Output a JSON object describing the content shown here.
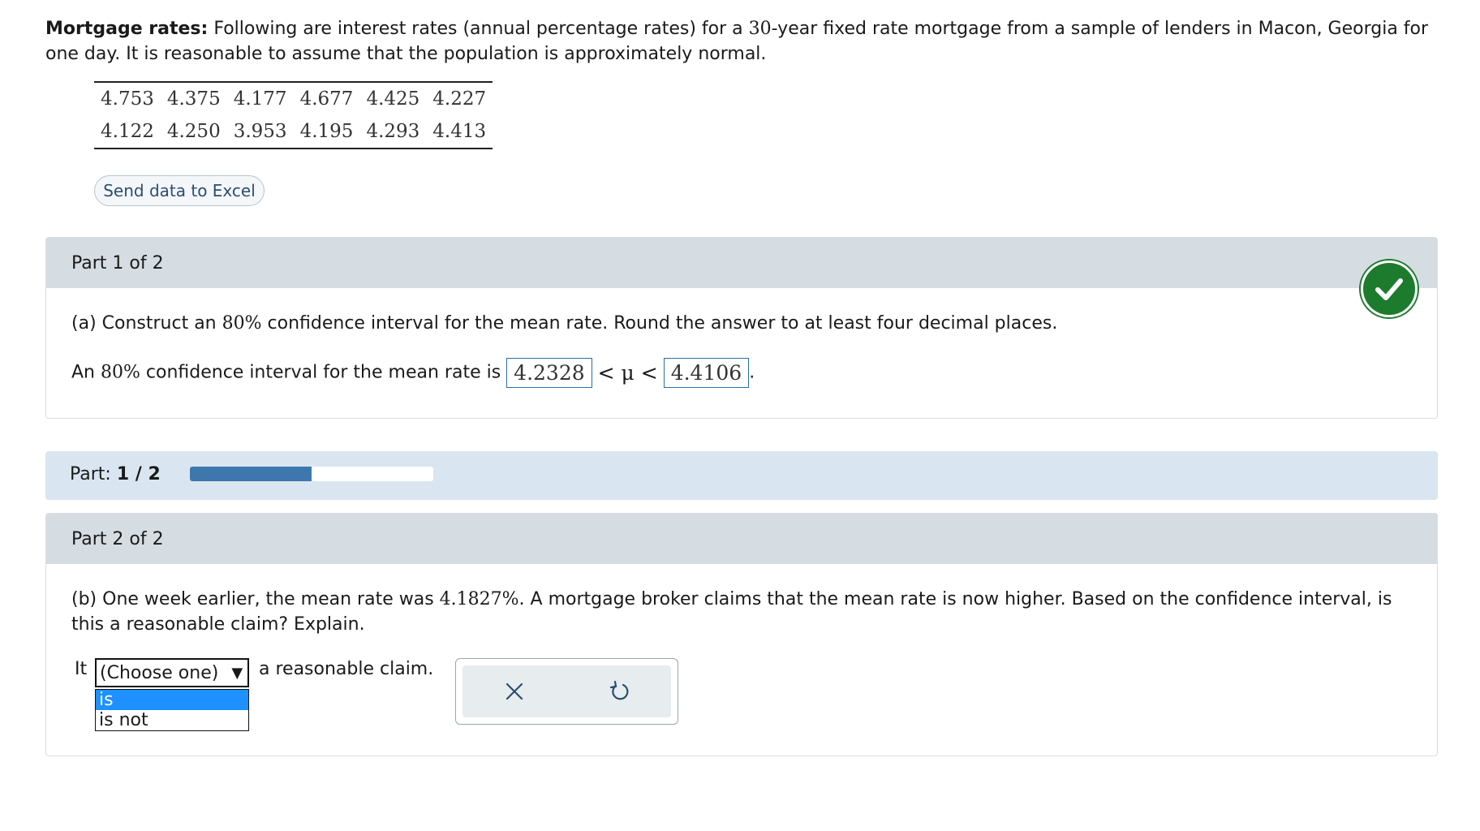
{
  "intro": {
    "heading": "Mortgage rates:",
    "text_a": " Following are interest rates (annual percentage rates) for a ",
    "num": "30",
    "text_b": "-year fixed rate mortgage from a sample of lenders in Macon, Georgia for one day. It is reasonable to assume that the population is approximately normal."
  },
  "data_rows": [
    [
      "4.753",
      "4.375",
      "4.177",
      "4.677",
      "4.425",
      "4.227"
    ],
    [
      "4.122",
      "4.250",
      "3.953",
      "4.195",
      "4.293",
      "4.413"
    ]
  ],
  "excel_button": "Send data to Excel",
  "part1": {
    "header": "Part 1 of 2",
    "question_a": "(a) Construct an ",
    "pct": "80%",
    "question_b": " confidence interval for the mean rate. Round the answer to at least four decimal places.",
    "answer_prefix_a": "An ",
    "answer_prefix_b": " confidence interval for the mean rate is ",
    "lower": "4.2328",
    "mu_symbol": "< μ <",
    "upper": "4.4106",
    "period": "."
  },
  "progress": {
    "label": "Part:",
    "value": "1 / 2",
    "fraction": 0.5
  },
  "part2": {
    "header": "Part 2 of 2",
    "question_a": "(b) One week earlier, the mean rate was ",
    "rate": "4.1827%",
    "question_b": ". A mortgage broker claims that the mean rate is now higher. Based on the confidence interval, is this a reasonable claim? Explain.",
    "sentence_start": "It",
    "sentence_end": "a reasonable claim.",
    "select_value": "(Choose one)",
    "select_arrow": "▼",
    "options": [
      "is",
      "is not"
    ]
  },
  "icons": {
    "check": "check-icon",
    "close": "close-icon",
    "undo": "undo-icon"
  },
  "colors": {
    "accent": "#3e77ae",
    "success": "#1d7b2e"
  }
}
